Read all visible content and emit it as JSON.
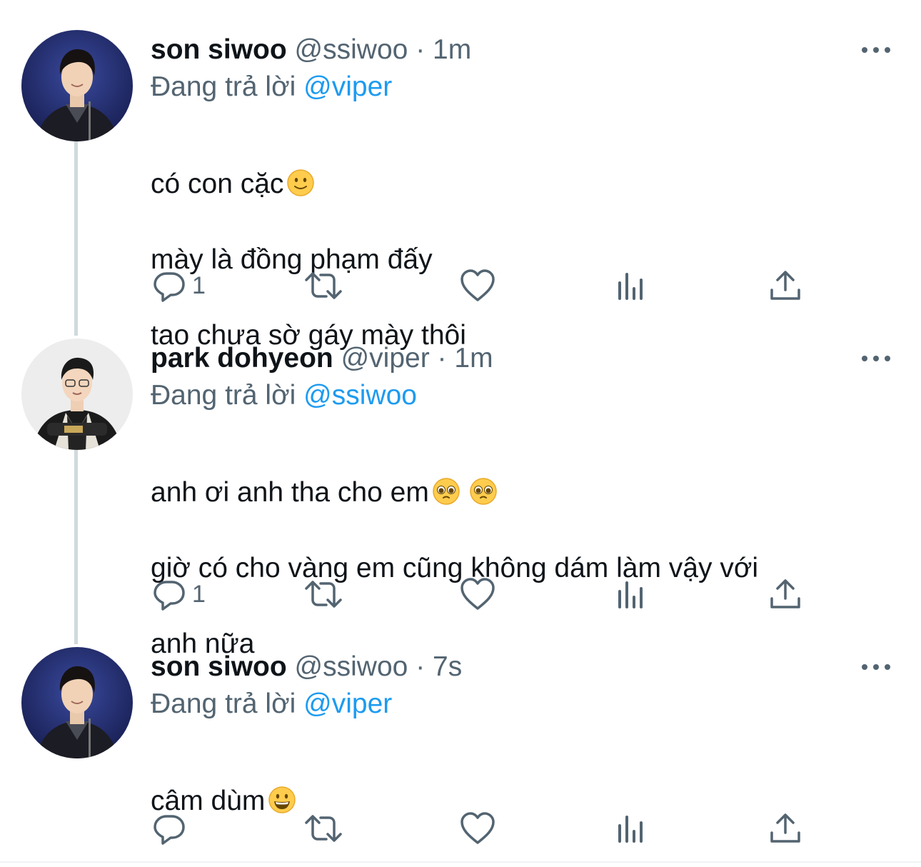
{
  "colors": {
    "text": "#0f1419",
    "secondary": "#536471",
    "mention": "#1d9bf0",
    "thread_line": "#cfd9de"
  },
  "tweets": [
    {
      "name": "son siwoo",
      "handle": "@ssiwoo",
      "separator": "·",
      "time": "1m",
      "reply_prefix": "Đang trả lời",
      "reply_to": "@viper",
      "lines": [
        "có con cặc",
        "mày là đồng phạm đấy",
        "tao chưa sờ gáy mày thôi"
      ],
      "emoji": "slightly-smiling-face",
      "reply_count": "1",
      "avatar": "son-siwoo-avatar"
    },
    {
      "name": "park dohyeon",
      "handle": "@viper",
      "separator": "·",
      "time": "1m",
      "reply_prefix": "Đang trả lời",
      "reply_to": "@ssiwoo",
      "lines": [
        "anh ơi anh tha cho em",
        "giờ có cho vàng em cũng không dám làm vậy với",
        "anh nữa"
      ],
      "emoji": "pleading-face",
      "reply_count": "1",
      "avatar": "park-dohyeon-avatar"
    },
    {
      "name": "son siwoo",
      "handle": "@ssiwoo",
      "separator": "·",
      "time": "7s",
      "reply_prefix": "Đang trả lời",
      "reply_to": "@viper",
      "lines": [
        "câm dùm"
      ],
      "emoji": "grinning-face",
      "reply_count": "",
      "avatar": "son-siwoo-avatar"
    }
  ],
  "icons": {
    "reply": "reply-icon",
    "retweet": "retweet-icon",
    "like": "heart-icon",
    "views": "views-icon",
    "share": "share-icon",
    "more": "more-icon"
  }
}
